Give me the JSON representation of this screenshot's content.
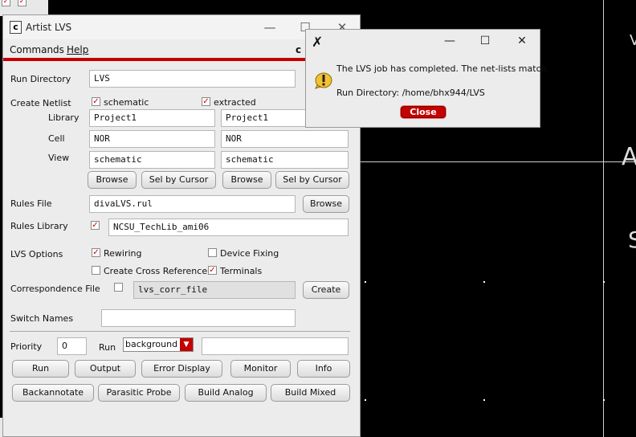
{
  "colors": {
    "accent": "#c40000",
    "layout_bg": "#000000",
    "window_bg": "#ececec"
  },
  "background": {
    "edge_glyphs": [
      "V",
      "A",
      "S"
    ]
  },
  "window": {
    "title": "Artist LVS",
    "icon": "cadence-icon",
    "controls": {
      "minimize": "—",
      "maximize": "☐",
      "close": "✕"
    },
    "menu": {
      "commands": "Commands",
      "help": "Help",
      "right_partial": "c"
    }
  },
  "form": {
    "run_directory": {
      "label": "Run Directory",
      "value": "LVS"
    },
    "create_netlist": {
      "label": "Create Netlist",
      "schematic": {
        "label": "schematic",
        "checked": true
      },
      "extracted": {
        "label": "extracted",
        "checked": true
      },
      "library": {
        "label": "Library",
        "schematic_value": "Project1",
        "extracted_value": "Project1"
      },
      "cell": {
        "label": "Cell",
        "schematic_value": "NOR",
        "extracted_value": "NOR"
      },
      "view": {
        "label": "View",
        "schematic_value": "schematic",
        "extracted_value": "schematic"
      },
      "browse_label": "Browse",
      "sel_by_cursor_label": "Sel by Cursor"
    },
    "rules_file": {
      "label": "Rules File",
      "value": "divaLVS.rul",
      "browse_label": "Browse"
    },
    "rules_library": {
      "label": "Rules Library",
      "checked": true,
      "value": "NCSU_TechLib_ami06"
    },
    "lvs_options": {
      "label": "LVS Options",
      "rewiring": {
        "label": "Rewiring",
        "checked": true
      },
      "device_fixing": {
        "label": "Device Fixing",
        "checked": false
      },
      "cross_reference": {
        "label": "Create Cross Reference",
        "checked": false
      },
      "terminals": {
        "label": "Terminals",
        "checked": true
      }
    },
    "correspondence_file": {
      "label": "Correspondence File",
      "checked": false,
      "value": "lvs_corr_file",
      "create_label": "Create"
    },
    "switch_names": {
      "label": "Switch Names",
      "value": ""
    },
    "priority": {
      "label": "Priority",
      "value": "0"
    },
    "run_mode": {
      "label": "Run",
      "selected": "background",
      "extra": ""
    }
  },
  "buttons": {
    "run": "Run",
    "output": "Output",
    "error_display": "Error Display",
    "monitor": "Monitor",
    "info": "Info",
    "backannotate": "Backannotate",
    "parasitic_probe": "Parasitic Probe",
    "build_analog": "Build Analog",
    "build_mixed": "Build Mixed"
  },
  "dialog": {
    "icon": "x-logo-icon",
    "message": "The LVS job has completed. The net-lists match.",
    "run_directory": "Run Directory: /home/bhx944/LVS",
    "close_label": "Close",
    "controls": {
      "minimize": "—",
      "maximize": "☐",
      "close": "✕"
    }
  }
}
